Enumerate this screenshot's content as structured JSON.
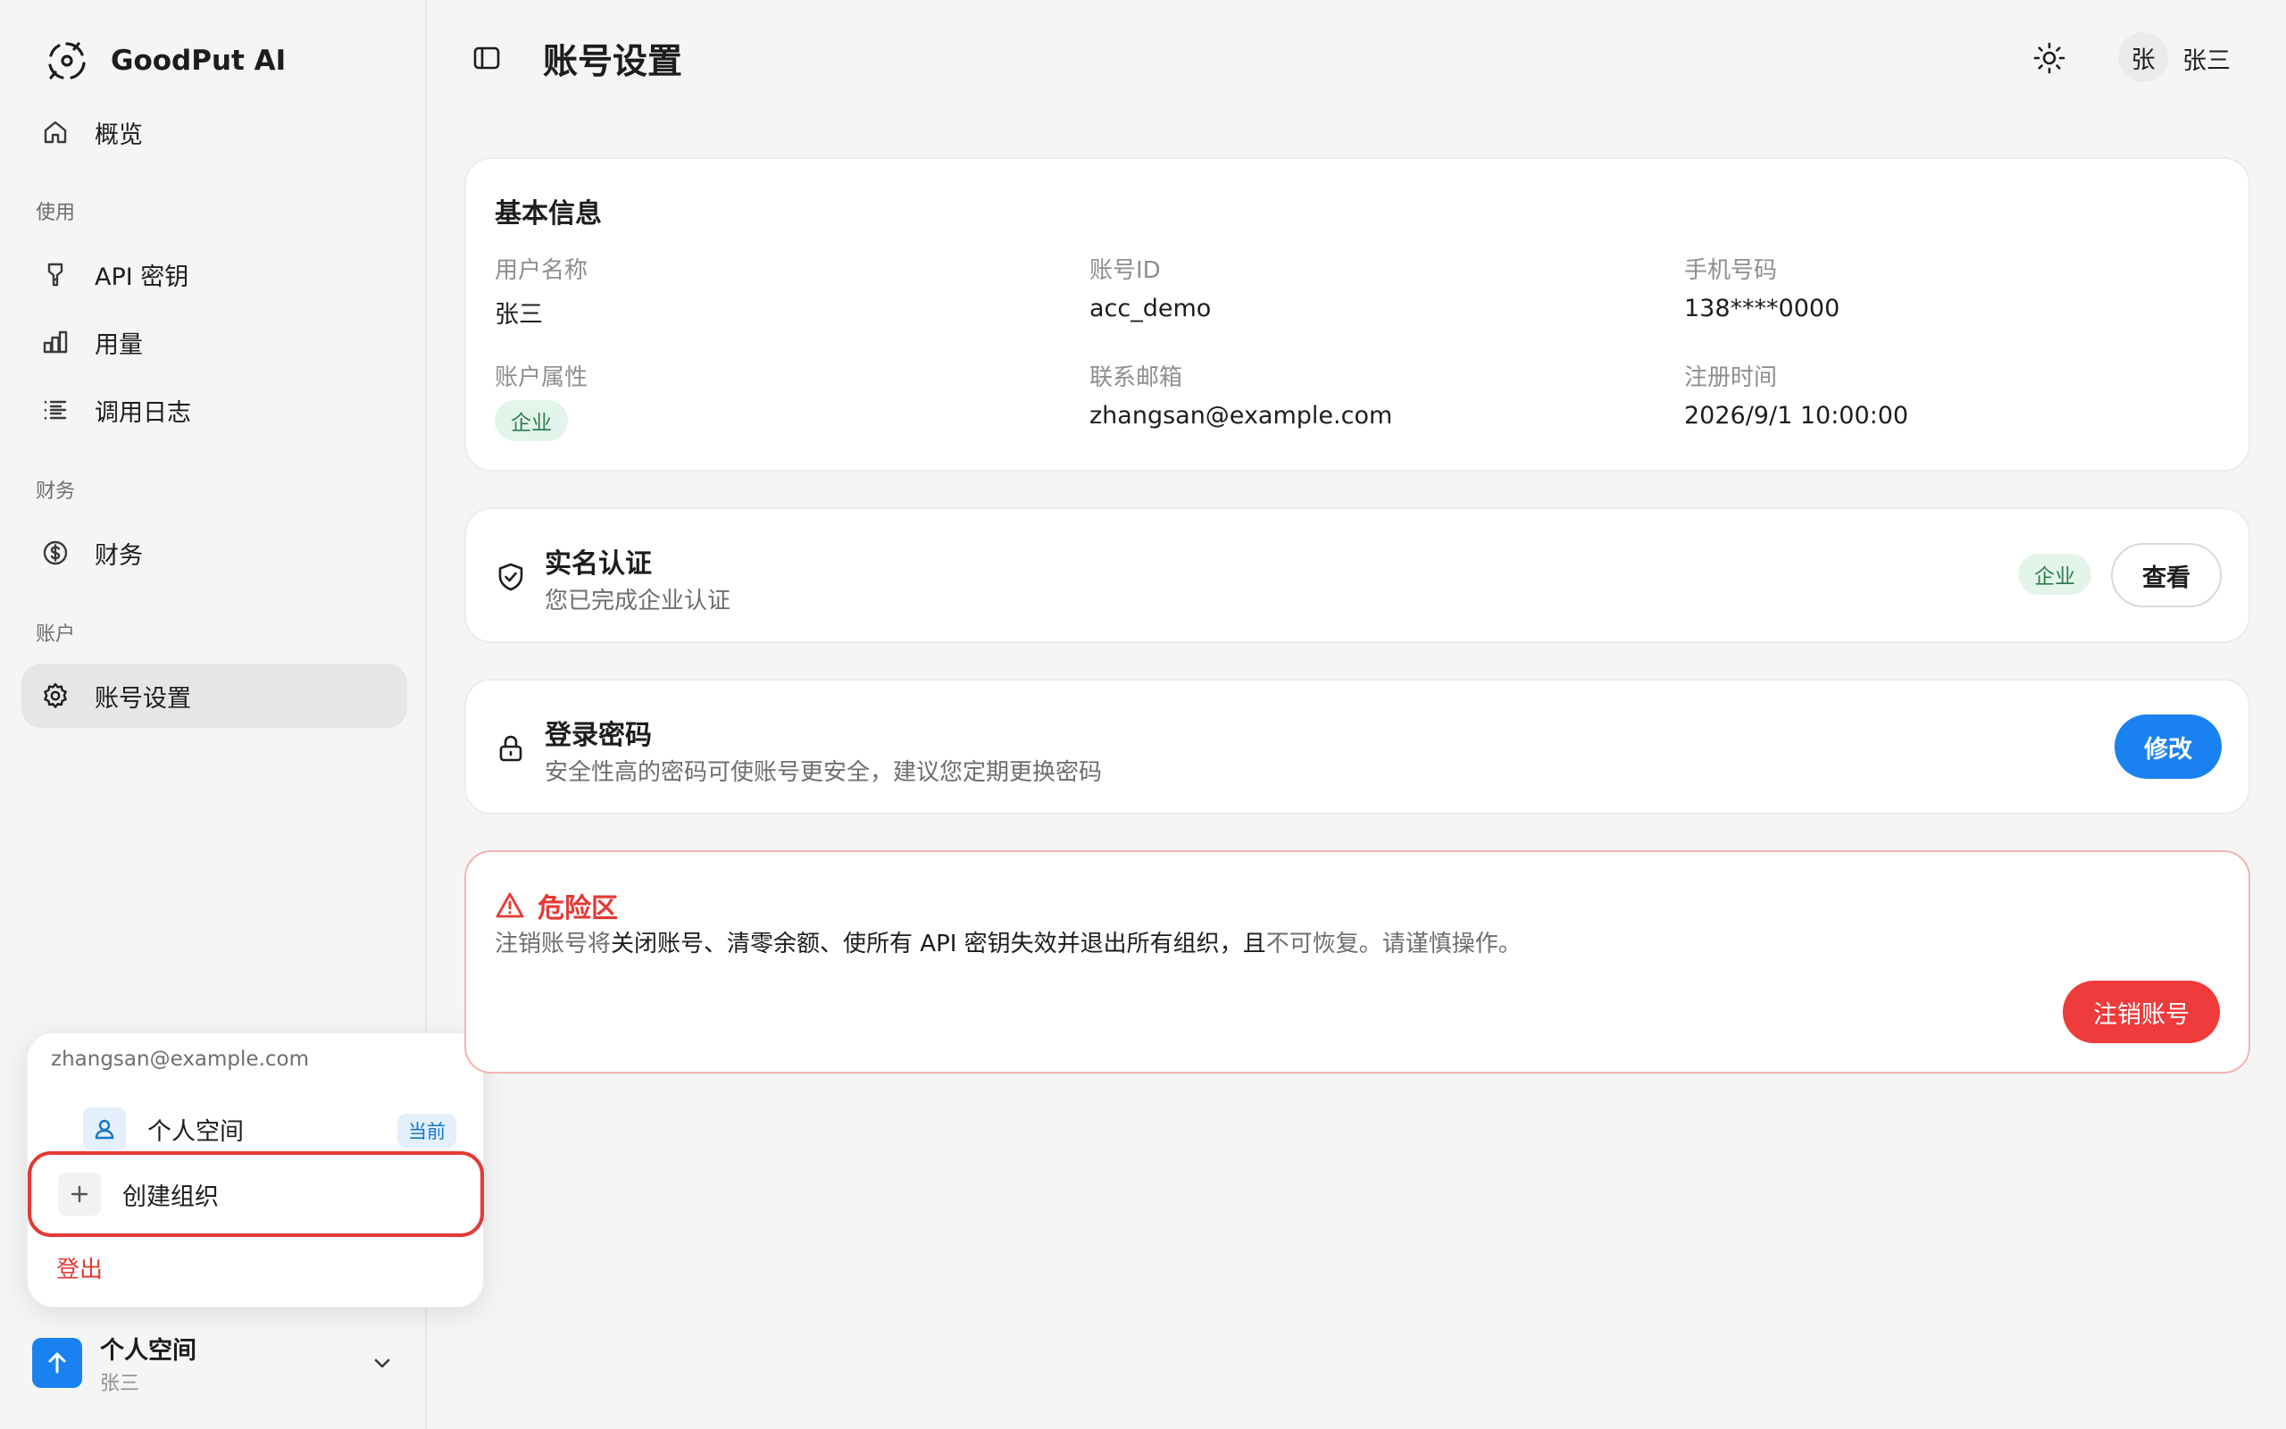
{
  "app": {
    "name": "GoodPut AI"
  },
  "sidebar": {
    "overview_label": "概览",
    "sections": {
      "use": "使用",
      "finance": "财务",
      "account": "账户"
    },
    "items": {
      "api_keys": "API 密钥",
      "usage": "用量",
      "logs": "调用日志",
      "finance": "财务",
      "account_settings": "账号设置"
    }
  },
  "workspace_popup": {
    "email": "zhangsan@example.com",
    "personal_label": "个人空间",
    "current_badge": "当前",
    "create_org_label": "创建组织",
    "logout_label": "登出"
  },
  "workspace_switcher": {
    "title": "个人空间",
    "subtitle": "张三"
  },
  "header": {
    "title": "账号设置",
    "avatar_char": "张",
    "user_name": "张三"
  },
  "basic_info": {
    "title": "基本信息",
    "fields": {
      "username_label": "用户名称",
      "username_value": "张三",
      "account_id_label": "账号ID",
      "account_id_value": "acc_demo",
      "phone_label": "手机号码",
      "phone_value": "138****0000",
      "account_type_label": "账户属性",
      "account_type_value": "企业",
      "email_label": "联系邮箱",
      "email_value": "zhangsan@example.com",
      "register_label": "注册时间",
      "register_value": "2026/9/1 10:00:00"
    }
  },
  "verification": {
    "title": "实名认证",
    "subtitle": "您已完成企业认证",
    "badge": "企业",
    "view_button": "查看"
  },
  "password": {
    "title": "登录密码",
    "subtitle": "安全性高的密码可使账号更安全，建议您定期更换密码",
    "edit_button": "修改"
  },
  "danger_zone": {
    "title": "危险区",
    "text_prefix": "注销账号将",
    "text_middle": "关闭账号、清零余额、使所有 API 密钥失效并退出所有组织，且",
    "text_suffix": "不可恢复。请谨慎操作。",
    "delete_button": "注销账号"
  },
  "colors": {
    "accent": "#1a82f0",
    "danger": "#ef3b3b",
    "success_bg": "#e3f5ea"
  }
}
